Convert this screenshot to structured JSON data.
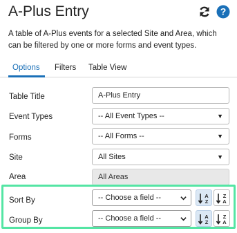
{
  "header": {
    "title": "A-Plus Entry",
    "description": "A table of A-Plus events for a selected Site and Area, which can be filtered by one or more forms and event types."
  },
  "tabs": [
    {
      "label": "Options",
      "active": true
    },
    {
      "label": "Filters",
      "active": false
    },
    {
      "label": "Table View",
      "active": false
    }
  ],
  "form": {
    "table_title": {
      "label": "Table Title",
      "value": "A-Plus Entry"
    },
    "event_types": {
      "label": "Event Types",
      "value": "-- All Event Types --"
    },
    "forms": {
      "label": "Forms",
      "value": "-- All Forms --"
    },
    "site": {
      "label": "Site",
      "value": "All Sites"
    },
    "area": {
      "label": "Area",
      "value": "All Areas"
    },
    "sort_by": {
      "label": "Sort By",
      "value": "-- Choose a field --"
    },
    "group_by": {
      "label": "Group By",
      "value": "-- Choose a field --"
    }
  },
  "icons": {
    "refresh": "refresh-icon",
    "help": "help-icon",
    "sort_asc": "sort-ascending-icon",
    "sort_desc": "sort-descending-icon"
  },
  "colors": {
    "accent": "#1a70b8",
    "highlight": "#54e5a4",
    "active_sort_bg": "#dbe8f5"
  }
}
